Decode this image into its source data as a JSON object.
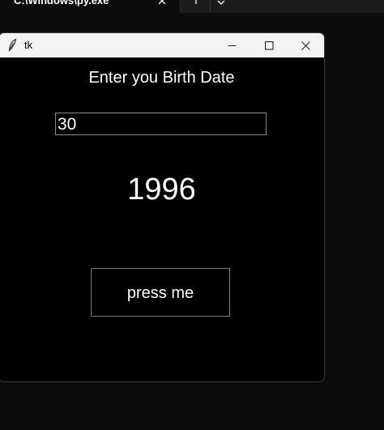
{
  "terminal": {
    "tab_title": "C:\\Windows\\py.exe",
    "close_icon": "close-icon",
    "new_tab_icon": "plus-icon",
    "dropdown_icon": "chevron-down-icon"
  },
  "window": {
    "title": "tk",
    "app_icon": "feather-icon",
    "controls": [
      "minimize",
      "maximize",
      "close"
    ]
  },
  "form": {
    "prompt_label": "Enter you Birth Date",
    "entry_value": "30",
    "result_text": "1996",
    "button_label": "press me"
  },
  "colors": {
    "window_bg": "#000000",
    "titlebar_bg": "#f3f3f3",
    "text": "#ffffff",
    "border": "#8a8a8a"
  }
}
